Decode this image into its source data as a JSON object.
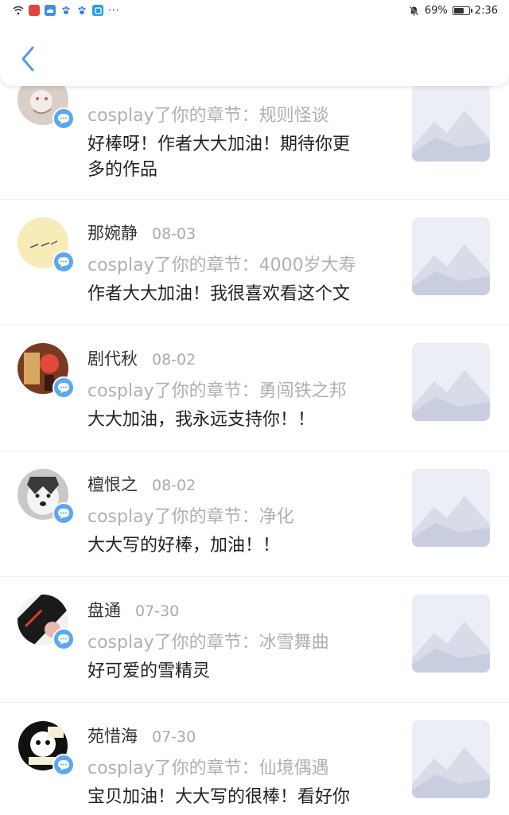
{
  "status_bar": {
    "left_icons": [
      "wifi-icon",
      "app-icon-red",
      "cloud-icon",
      "paw-icon",
      "paw-icon",
      "app-icon-blue"
    ],
    "more": "···",
    "battery_percent": "69%",
    "battery_level": 0.69,
    "time": "2:36"
  },
  "header": {
    "back_icon": "chevron-left-icon"
  },
  "colors": {
    "accent": "#4a9ee8",
    "badge": "#5aa8f0",
    "muted": "#b0b0b0"
  },
  "comments": [
    {
      "name": "",
      "date": "",
      "chapter": "cosplay了你的章节：规则怪谈",
      "comment_lines": [
        "好棒呀！作者大大加油！期待你更",
        "多的作品"
      ]
    },
    {
      "name": "那婉静",
      "date": "08-03",
      "chapter": "cosplay了你的章节：4000岁大寿",
      "comment_lines": [
        "作者大大加油！我很喜欢看这个文"
      ]
    },
    {
      "name": "剧代秋",
      "date": "08-02",
      "chapter": "cosplay了你的章节：勇闯铁之邦",
      "comment_lines": [
        "大大加油，我永远支持你！！"
      ]
    },
    {
      "name": "檀恨之",
      "date": "08-02",
      "chapter": "cosplay了你的章节：净化",
      "comment_lines": [
        "大大写的好棒，加油！！"
      ]
    },
    {
      "name": "盘通",
      "date": "07-30",
      "chapter": "cosplay了你的章节：冰雪舞曲",
      "comment_lines": [
        "好可爱的雪精灵"
      ]
    },
    {
      "name": "苑惜海",
      "date": "07-30",
      "chapter": "cosplay了你的章节：仙境偶遇",
      "comment_lines": [
        "宝贝加油！大大写的很棒！看好你"
      ]
    }
  ]
}
